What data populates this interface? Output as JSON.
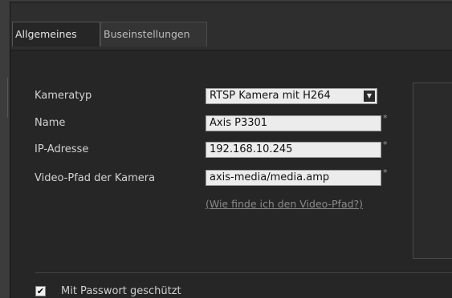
{
  "tabs": [
    {
      "label": "Allgemeines"
    },
    {
      "label": "Buseinstellungen"
    }
  ],
  "form": {
    "camera_type": {
      "label": "Kameratyp",
      "value": "RTSP Kamera mit H264"
    },
    "name": {
      "label": "Name",
      "value": "Axis P3301"
    },
    "ip_address": {
      "label": "IP-Adresse",
      "value": "192.168.10.245"
    },
    "video_path": {
      "label": "Video-Pfad der Kamera",
      "value": "axis-media/media.amp"
    },
    "required_marker": "*",
    "help_link": "(Wie finde ich den Video-Pfad?)"
  },
  "password": {
    "label": "Mit Passwort geschützt",
    "checked": true
  },
  "icons": {
    "select_arrow": "chevron-down-icon",
    "check": "check-icon"
  }
}
